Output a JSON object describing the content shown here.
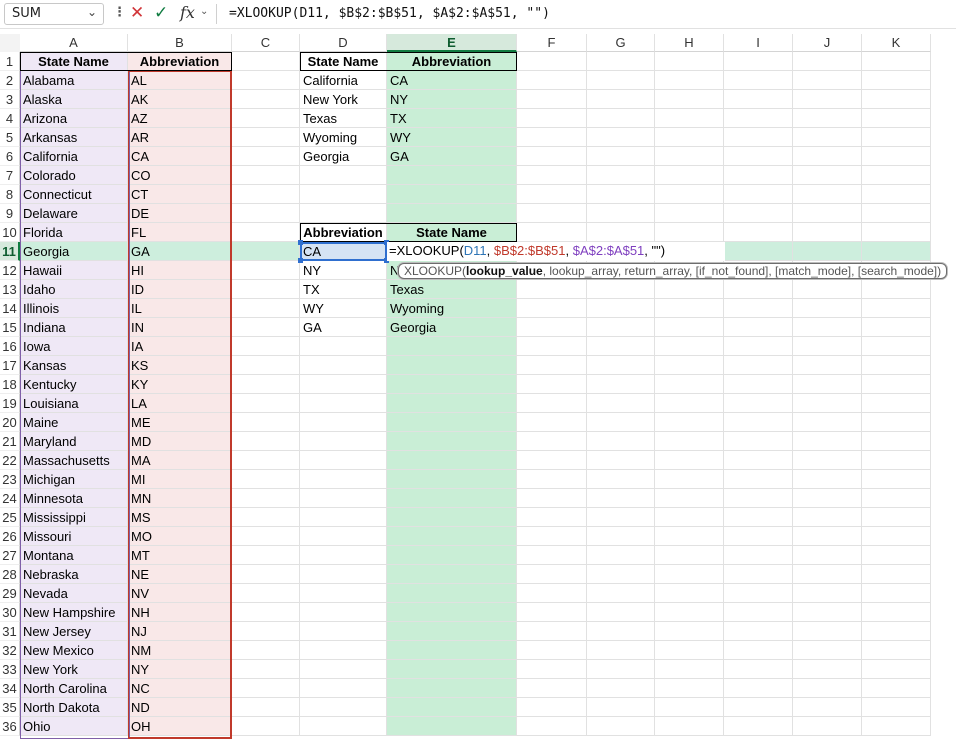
{
  "formula_bar": {
    "name_box": "SUM",
    "name_box_icon": "chevron-down-icon",
    "more_icon": "vertical-dots-icon",
    "cancel_icon": "close-icon",
    "enter_icon": "check-icon",
    "fx_label": "fx",
    "formula": "=XLOOKUP(D11, $B$2:$B$51, $A$2:$A$51, \"\")"
  },
  "columns": [
    "A",
    "B",
    "C",
    "D",
    "E",
    "F",
    "G",
    "H",
    "I",
    "J",
    "K"
  ],
  "rows": [
    "1",
    "2",
    "3",
    "4",
    "5",
    "6",
    "7",
    "8",
    "9",
    "10",
    "11",
    "12",
    "13",
    "14",
    "15",
    "16",
    "17",
    "18",
    "19",
    "20",
    "21",
    "22",
    "23",
    "24",
    "25",
    "26",
    "27",
    "28",
    "29",
    "30",
    "31",
    "32",
    "33",
    "34",
    "35",
    "36"
  ],
  "table1": {
    "headers": [
      "State Name",
      "Abbreviation"
    ],
    "rows": [
      [
        "Alabama",
        "AL"
      ],
      [
        "Alaska",
        "AK"
      ],
      [
        "Arizona",
        "AZ"
      ],
      [
        "Arkansas",
        "AR"
      ],
      [
        "California",
        "CA"
      ],
      [
        "Colorado",
        "CO"
      ],
      [
        "Connecticut",
        "CT"
      ],
      [
        "Delaware",
        "DE"
      ],
      [
        "Florida",
        "FL"
      ],
      [
        "Georgia",
        "GA"
      ],
      [
        "Hawaii",
        "HI"
      ],
      [
        "Idaho",
        "ID"
      ],
      [
        "Illinois",
        "IL"
      ],
      [
        "Indiana",
        "IN"
      ],
      [
        "Iowa",
        "IA"
      ],
      [
        "Kansas",
        "KS"
      ],
      [
        "Kentucky",
        "KY"
      ],
      [
        "Louisiana",
        "LA"
      ],
      [
        "Maine",
        "ME"
      ],
      [
        "Maryland",
        "MD"
      ],
      [
        "Massachusetts",
        "MA"
      ],
      [
        "Michigan",
        "MI"
      ],
      [
        "Minnesota",
        "MN"
      ],
      [
        "Mississippi",
        "MS"
      ],
      [
        "Missouri",
        "MO"
      ],
      [
        "Montana",
        "MT"
      ],
      [
        "Nebraska",
        "NE"
      ],
      [
        "Nevada",
        "NV"
      ],
      [
        "New Hampshire",
        "NH"
      ],
      [
        "New Jersey",
        "NJ"
      ],
      [
        "New Mexico",
        "NM"
      ],
      [
        "New York",
        "NY"
      ],
      [
        "North Carolina",
        "NC"
      ],
      [
        "North Dakota",
        "ND"
      ],
      [
        "Ohio",
        "OH"
      ]
    ]
  },
  "table2": {
    "headers": [
      "State Name",
      "Abbreviation"
    ],
    "rows": [
      [
        "California",
        "CA"
      ],
      [
        "New York",
        "NY"
      ],
      [
        "Texas",
        "TX"
      ],
      [
        "Wyoming",
        "WY"
      ],
      [
        "Georgia",
        "GA"
      ]
    ]
  },
  "table3": {
    "headers": [
      "Abbreviation",
      "State Name"
    ],
    "rows": [
      [
        "CA",
        ""
      ],
      [
        "NY",
        "N"
      ],
      [
        "TX",
        "Texas"
      ],
      [
        "WY",
        "Wyoming"
      ],
      [
        "GA",
        "Georgia"
      ]
    ]
  },
  "edit_cell": {
    "prefix": "=XLOOKUP(",
    "ref1": "D11",
    "sep1": ", ",
    "ref2": "$B$2:$B$51",
    "sep2": ", ",
    "ref3": "$A$2:$A$51",
    "suffix": ", \"\")"
  },
  "tooltip": {
    "fn": "XLOOKUP(",
    "active_arg": "lookup_value",
    "rest": ", lookup_array, return_array, [if_not_found], [match_mode], [search_mode])"
  },
  "colors": {
    "col_a_fill": "#efe8f6",
    "col_b_fill": "#f9e8e8",
    "col_e_fill": "#c9eed6",
    "active_row": "#cdeedd",
    "accent_green": "#107c41"
  }
}
